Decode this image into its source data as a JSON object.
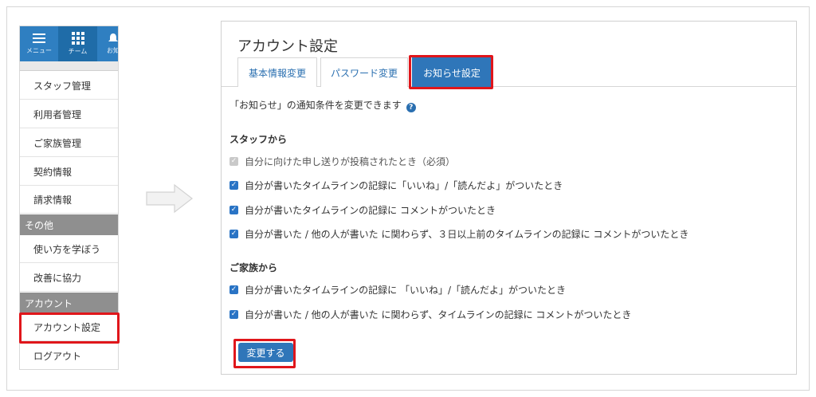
{
  "sidebar": {
    "top_tiles": [
      {
        "label": "メニュー",
        "icon": "hamburger-icon"
      },
      {
        "label": "チーム",
        "icon": "grid-icon"
      },
      {
        "label": "お知",
        "icon": "notification-icon"
      }
    ],
    "items": [
      {
        "label": "スタッフ管理"
      },
      {
        "label": "利用者管理"
      },
      {
        "label": "ご家族管理"
      },
      {
        "label": "契約情報"
      },
      {
        "label": "請求情報"
      }
    ],
    "section_other": "その他",
    "other_items": [
      {
        "label": "使い方を学ぼう"
      },
      {
        "label": "改善に協力"
      }
    ],
    "section_account": "アカウント",
    "account_items": [
      {
        "label": "アカウント設定"
      },
      {
        "label": "ログアウト"
      }
    ]
  },
  "panel": {
    "title": "アカウント設定",
    "tabs": [
      {
        "label": "基本情報変更"
      },
      {
        "label": "パスワード変更"
      },
      {
        "label": "お知らせ設定"
      }
    ],
    "description": "「お知らせ」の通知条件を変更できます",
    "staff_heading": "スタッフから",
    "staff_options": [
      {
        "label": "自分に向けた申し送りが投稿されたとき（必須）",
        "checked": true,
        "disabled": true
      },
      {
        "label": "自分が書いたタイムラインの記録に「いいね」/「読んだよ」がついたとき",
        "checked": true
      },
      {
        "label": "自分が書いたタイムラインの記録に コメントがついたとき",
        "checked": true
      },
      {
        "label": "自分が書いた / 他の人が書いた に関わらず、３日以上前のタイムラインの記録に コメントがついたとき",
        "checked": true
      }
    ],
    "family_heading": "ご家族から",
    "family_options": [
      {
        "label": "自分が書いたタイムラインの記録に 「いいね」/「読んだよ」がついたとき",
        "checked": true
      },
      {
        "label": "自分が書いた / 他の人が書いた に関わらず、タイムラインの記録に コメントがついたとき",
        "checked": true
      }
    ],
    "submit_label": "変更する"
  },
  "colors": {
    "accent": "#2f76b9",
    "highlight": "#e0161b",
    "section_bg": "#8f8f8f"
  }
}
